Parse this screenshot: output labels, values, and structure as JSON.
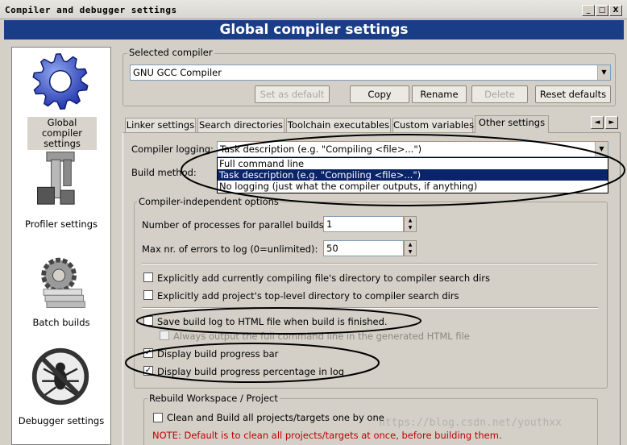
{
  "window": {
    "title": "Compiler and debugger settings",
    "min": "_",
    "max": "□",
    "close": "X"
  },
  "header": {
    "title": "Global compiler settings"
  },
  "sidebar": {
    "items": [
      {
        "label_lines": [
          "Global compiler",
          "settings"
        ]
      },
      {
        "label": "Profiler settings"
      },
      {
        "label": "Batch builds"
      },
      {
        "label": "Debugger settings"
      }
    ]
  },
  "selected_compiler": {
    "group_label": "Selected compiler",
    "value": "GNU GCC Compiler",
    "buttons": {
      "set_default": "Set as default",
      "copy": "Copy",
      "rename": "Rename",
      "delete": "Delete",
      "reset": "Reset defaults"
    }
  },
  "tabs": [
    "Linker settings",
    "Search directories",
    "Toolchain executables",
    "Custom variables",
    "Other settings"
  ],
  "tab_scroll": {
    "left": "◄",
    "right": "►"
  },
  "other": {
    "logging_label": "Compiler logging:",
    "logging_value": "Task description (e.g. \"Compiling <file>...\")",
    "logging_options": [
      "Full command line",
      "Task description (e.g. \"Compiling <file>...\")",
      "No logging (just what the compiler outputs, if anything)"
    ],
    "logging_selected": 1,
    "build_method_label": "Build method:",
    "indep_group": "Compiler-independent options",
    "parallel_label": "Number of processes for parallel builds:",
    "parallel_value": "1",
    "maxerr_label": "Max nr. of errors to log (0=unlimited):",
    "maxerr_value": "50",
    "checks": [
      {
        "label": "Explicitly add currently compiling file's directory to compiler search dirs",
        "checked": false
      },
      {
        "label": "Explicitly add project's top-level directory to compiler search dirs",
        "checked": false
      },
      {
        "label": "Save build log to HTML file when build is finished.",
        "checked": false
      },
      {
        "label": "Always output the full command line in the generated HTML file",
        "checked": false,
        "disabled": true
      },
      {
        "label": "Display build progress bar",
        "checked": true
      },
      {
        "label": "Display build progress percentage in log",
        "checked": true
      }
    ],
    "rebuild_group": "Rebuild Workspace / Project",
    "rebuild_check": "Clean and Build all projects/targets one by one",
    "rebuild_note": "NOTE: Default is to clean all projects/targets at once, before building them."
  },
  "watermark": "https://blog.csdn.net/youthxx",
  "colors": {
    "header_bg": "#1a3d87",
    "selection": "#0a246a",
    "note": "#c00000"
  }
}
